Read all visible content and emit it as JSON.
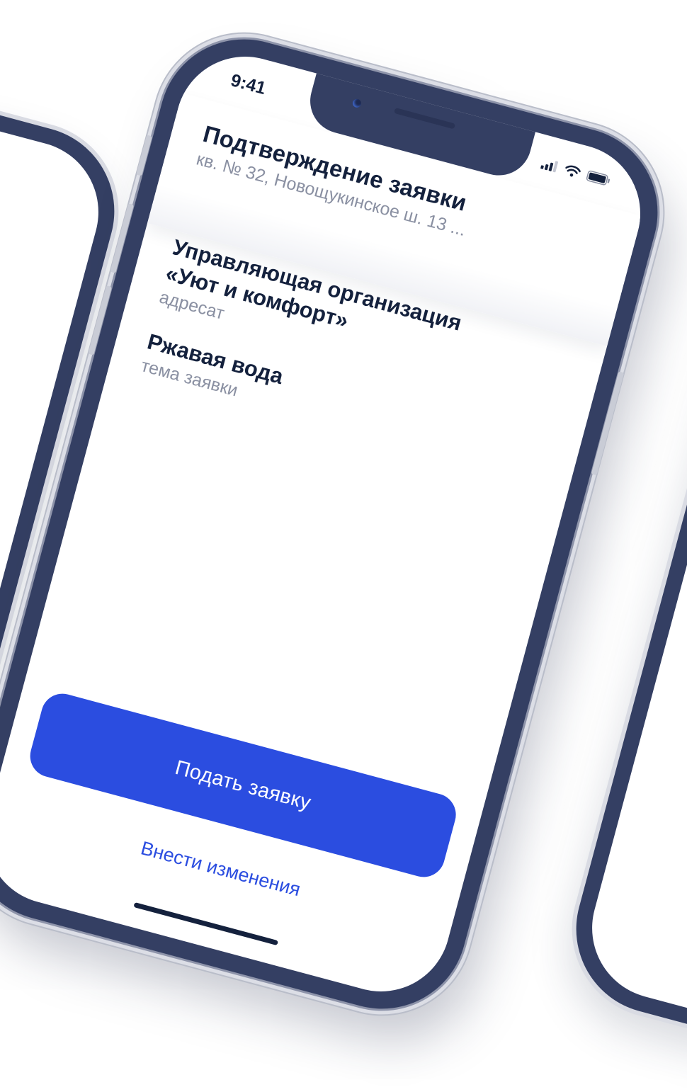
{
  "status_bar": {
    "time": "9:41",
    "icons": [
      "signal-icon",
      "wifi-icon",
      "battery-icon"
    ]
  },
  "header": {
    "title": "Подтверждение заявки",
    "subtitle": "кв. № 32, Новощукинское ш. 13 ..."
  },
  "fields": [
    {
      "value": "Управляющая организация\n«Уют и комфорт»",
      "label": "адресат"
    },
    {
      "value": "Ржавая вода",
      "label": "тема заявки"
    }
  ],
  "actions": {
    "submit_label": "Подать заявку",
    "edit_label": "Внести изменения"
  },
  "colors": {
    "frame": "#343f63",
    "accent": "#2b4de0",
    "text_primary": "#14213d",
    "text_secondary": "#8a90a2"
  }
}
